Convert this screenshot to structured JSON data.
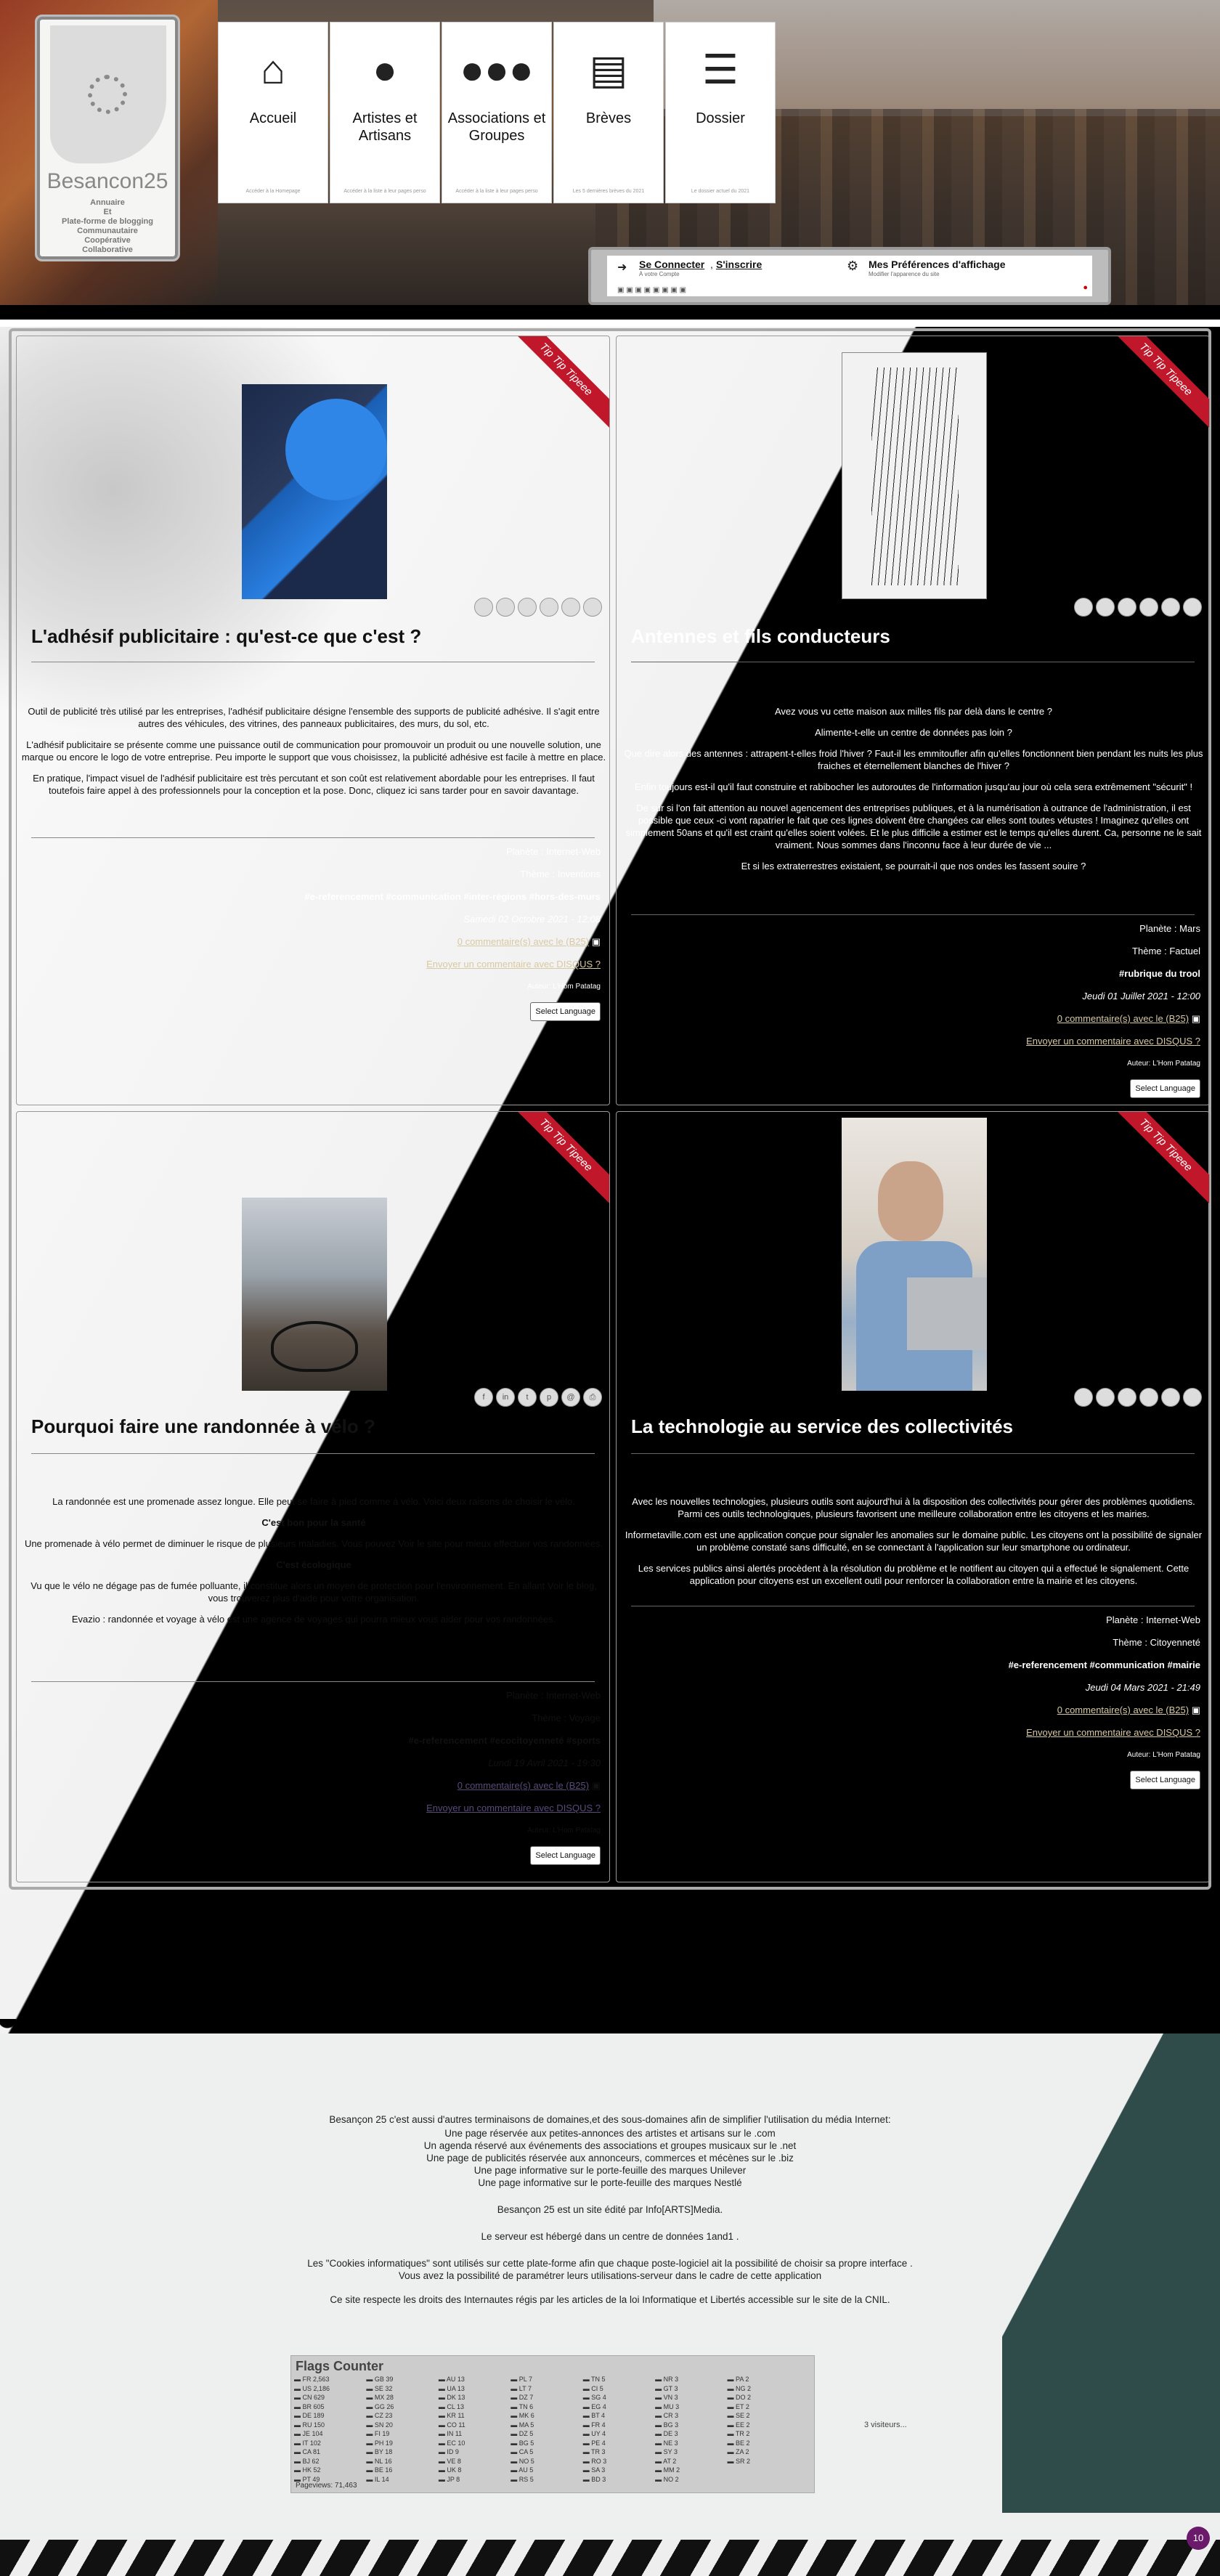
{
  "header": {
    "logo": {
      "name": "Besancon25",
      "tagline": [
        "Annuaire",
        "Et",
        "Plate-forme de blogging",
        "Communautaire",
        "Coopérative",
        "Collaborative"
      ]
    },
    "nav": [
      {
        "label": "Accueil",
        "hint": "Accéder à la Homepage",
        "icon": "home-icon"
      },
      {
        "label": "Artistes et Artisans",
        "hint": "Accéder à la liste à leur pages perso",
        "icon": "user-icon"
      },
      {
        "label": "Associations et Groupes",
        "hint": "Accéder à la liste à leur pages perso",
        "icon": "users-icon"
      },
      {
        "label": "Brèves",
        "hint": "Les 5 dernières brèves du 2021",
        "icon": "document-icon"
      },
      {
        "label": "Dossier",
        "hint": "Le dossier actuel du 2021",
        "icon": "list-icon"
      }
    ],
    "userbar": {
      "connect": "Se Connecter",
      "sep": ",",
      "register": "S'inscrire",
      "connect_sub": "À votre Compte",
      "prefs": "Mes Préférences d'affichage",
      "prefs_sub": "Modifier l'apparence du site",
      "flags": "▣ ▣ ▣ ▣ ▣ ▣ ▣ ▣"
    }
  },
  "articles": [
    {
      "ribbon": "Tip Tip Tipeee",
      "title": "L'adhésif publicitaire : qu'est-ce que c'est ?",
      "paragraphs": [
        "Outil de publicité très utilisé par les entreprises, l'adhésif publicitaire désigne l'ensemble des supports de publicité adhésive. Il s'agit entre autres des véhicules, des vitrines, des panneaux publicitaires, des murs, du sol, etc.",
        "L'adhésif publicitaire se présente comme une puissance outil de communication pour promouvoir un produit ou une nouvelle solution, une marque ou encore le logo de votre entreprise. Peu importe le support que vous choisissez, la publicité adhésive est facile à mettre en place.",
        "En pratique, l'impact visuel de l'adhésif publicitaire est très percutant et son coût est relativement abordable pour les entreprises. Il faut toutefois faire appel à des professionnels pour la conception et la pose. Donc, cliquez ici sans tarder pour en savoir davantage."
      ],
      "planet_label": "Planète :",
      "planet": "Internet-Web",
      "theme_label": "Thème :",
      "theme": "Inventions",
      "tags": "#e-referencement #communication #inter-régions #hors-des-murs",
      "date": "Samedi 02 Octobre 2021 - 12:08",
      "comments": "0 commentaire(s) avec le (B25)",
      "disqus": "Envoyer un commentaire avec DISQUS ?",
      "author_label": "Auteur:",
      "author": "L'Hom Patatag",
      "lang": "Select Language"
    },
    {
      "ribbon": "Tip Tip Tipeee",
      "title": "Antennes et fils conducteurs",
      "paragraphs": [
        "Avez vous vu cette maison aux milles fils par delà dans le centre ?",
        "Alimente-t-elle un centre de données pas loin ?",
        "Que dire alors des antennes : attrapent-t-elles froid l'hiver ? Faut-il les emmitoufler afin qu'elles fonctionnent bien pendant les nuits les plus fraiches et éternellement blanches de l'hiver ?",
        "Enfin toujours est-il qu'il faut construire et rabibocher les autoroutes de l'information jusqu'au jour où cela sera extrêmement \"sécurit\" !",
        "De sur si l'on fait attention au nouvel agencement des entreprises publiques, et à la numérisation à outrance de l'administration, il est possible que ceux -ci vont rapatrier le fait que ces lignes doivent être changées car elles sont toutes vétustes ! Imaginez qu'elles ont simplement 50ans et qu'il est craint qu'elles soient volées. Et le plus difficile a estimer est le temps qu'elles durent. Ca, personne ne le sait vraiment. Nous sommes dans l'inconnu face à leur durée de vie ...",
        "Et si les extraterrestres existaient, se pourrait-il que nos ondes les fassent souire ?"
      ],
      "planet_label": "Planète :",
      "planet": "Mars",
      "theme_label": "Thème :",
      "theme": "Factuel",
      "tags": "#rubrique du trool",
      "date": "Jeudi 01 Juillet 2021 - 12:00",
      "comments": "0 commentaire(s) avec le (B25)",
      "disqus": "Envoyer un commentaire avec DISQUS ?",
      "author_label": "Auteur:",
      "author": "L'Hom Patatag",
      "lang": "Select Language"
    },
    {
      "ribbon": "Tip Tip Tipeee",
      "title": "Pourquoi faire une randonnée à vélo ?",
      "paragraphs": [
        "La randonnée est une promenade assez longue. Elle peut se faire à pied comme à vélo. Voici deux raisons de choisir le vélo.",
        "C'est bon pour la santé",
        "Une promenade à vélo permet de diminuer le risque de plusieurs maladies. Vous pouvez Voir le site pour mieux effectuer vos randonnées.",
        "C'est écologique",
        "Vu que le vélo ne dégage pas de fumée polluante, il constitue alors un moyen de protection pour l'environnement. En allant Voir le blog, vous trouverez plus d'aide pour votre organisation.",
        "Evazio : randonnée et voyage à vélo est une agence de voyages qui pourra mieux vous aider pour vos randonnées."
      ],
      "planet_label": "Planète :",
      "planet": "Internet-Web",
      "theme_label": "Thème :",
      "theme": "Voyage",
      "tags": "#e-referencement #ecocitoyenneté #sports",
      "date": "Lundi 19 Avril 2021 - 19:30",
      "comments": "0 commentaire(s) avec le (B25)",
      "disqus": "Envoyer un commentaire avec DISQUS ?",
      "author_label": "Auteur:",
      "author": "L'Hom Patatag",
      "lang": "Select Language"
    },
    {
      "ribbon": "Tip Tip Tipeee",
      "title": "La technologie au service des collectivités",
      "paragraphs": [
        "Avec les nouvelles technologies, plusieurs outils sont aujourd'hui à la disposition des collectivités pour gérer des problèmes quotidiens. Parmi ces outils technologiques, plusieurs favorisent une meilleure collaboration entre les citoyens et les mairies.",
        "Informetaville.com est une application conçue pour signaler les anomalies sur le domaine public. Les citoyens ont la possibilité de signaler un problème constaté sans difficulté, en se connectant à l'application sur leur smartphone ou ordinateur.",
        "Les services publics ainsi alertés procèdent à la résolution du problème et le notifient au citoyen qui a effectué le signalement. Cette application pour citoyens est un excellent outil pour renforcer la collaboration entre la mairie et les citoyens."
      ],
      "planet_label": "Planète :",
      "planet": "Internet-Web",
      "theme_label": "Thème :",
      "theme": "Citoyenneté",
      "tags": "#e-referencement #communication #mairie",
      "date": "Jeudi 04 Mars 2021 - 21:49",
      "comments": "0 commentaire(s) avec le (B25)",
      "disqus": "Envoyer un commentaire avec DISQUS ?",
      "author_label": "Auteur:",
      "author": "L'Hom Patatag",
      "lang": "Select Language"
    }
  ],
  "footer": {
    "intro": "Besançon 25 c'est aussi d'autres terminaisons de domaines,et des sous-domaines afin de simplifier l'utilisation du média Internet:",
    "lines": [
      "Une page réservée aux petites-annonces des artistes et artisans sur le .com",
      "Un agenda réservé aux événements des associations et groupes musicaux sur le .net",
      "Une page de publicités réservée aux annonceurs, commerces et mécènes sur le .biz",
      "Une page informative sur le porte-feuille des marques Unilever",
      "Une page informative sur le porte-feuille des marques Nestlé"
    ],
    "editor": "Besançon 25 est un site édité par Info[ARTS]Media.",
    "server": "Le serveur est hébergé dans un centre de données 1and1 .",
    "cookies1": "Les \"Cookies informatiques\" sont utilisés sur cette plate-forme afin que chaque poste-logiciel ait la possibilité de choisir sa propre interface .",
    "cookies2": "Vous avez la possibilité de paramétrer leurs utilisations-serveur dans le cadre de cette application",
    "rights": "Ce site respecte les droits des Internautes régis par les articles de la loi Informatique et Libertés accessible sur le site de la CNIL.",
    "flags_counter": {
      "title": "Flags Counter",
      "entries": [
        "FR 2,563",
        "US 2,186",
        "CN 629",
        "BR 605",
        "DE 189",
        "RU 150",
        "JE 104",
        "IT 102",
        "CA 81",
        "BJ 62",
        "HK 52",
        "PT 49",
        "GB 39",
        "SE 32",
        "MX 28",
        "GG 26",
        "CZ 23",
        "SN 20",
        "FI 19",
        "PH 19",
        "BY 18",
        "NL 16",
        "BE 16",
        "IL 14",
        "AU 13",
        "UA 13",
        "DK 13",
        "CL 13",
        "KR 11",
        "CO 11",
        "IN 11",
        "EC 10",
        "ID 9",
        "VE 8",
        "UK 8",
        "JP 8",
        "PL 7",
        "LT 7",
        "DZ 7",
        "TN 6",
        "MK 6",
        "MA 5",
        "DZ 5",
        "BG 5",
        "CA 5",
        "NO 5",
        "AU 5",
        "RS 5",
        "TN 5",
        "CI 5",
        "SG 4",
        "EG 4",
        "BT 4",
        "FR 4",
        "UY 4",
        "PE 4",
        "TR 3",
        "RO 3",
        "SA 3",
        "BD 3",
        "NR 3",
        "GT 3",
        "VN 3",
        "MU 3",
        "CR 3",
        "BG 3",
        "DE 3",
        "NE 3",
        "SY 3",
        "AT 2",
        "MM 2",
        "NO 2",
        "PA 2",
        "NG 2",
        "DO 2",
        "ET 2",
        "SE 2",
        "EE 2",
        "TR 2",
        "BE 2",
        "ZA 2",
        "SR 2"
      ],
      "pageviews": "Pageviews: 71,463"
    },
    "visitors": "3 visiteurs...",
    "badge": "10"
  }
}
